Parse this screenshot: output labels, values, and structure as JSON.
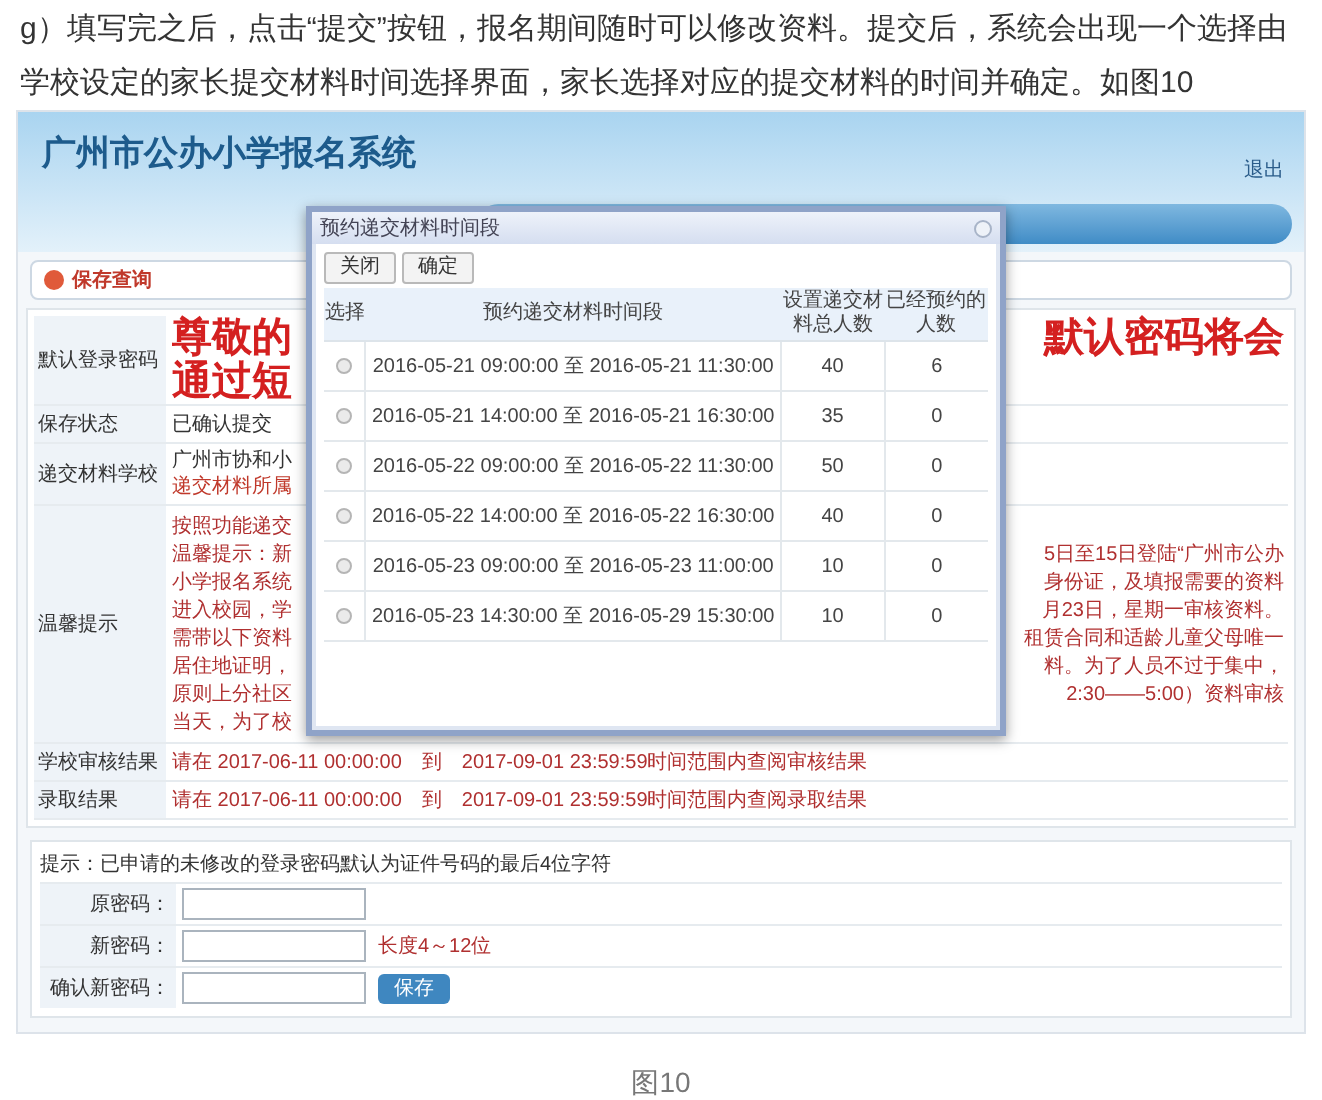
{
  "article": {
    "paragraph": "g）填写完之后，点击“提交”按钮，报名期间随时可以修改资料。提交后，系统会出现一个选择由学校设定的家长提交材料时间选择界面，家长选择对应的提交材料的时间并确定。如图10",
    "caption": "图10"
  },
  "app": {
    "title": "广州市公办小学报名系统",
    "logout": "退出",
    "save_query": "保存查询",
    "info_rows": [
      {
        "kind": "notice",
        "label": "默认登录密码",
        "left": [
          "尊敬的",
          "通过短"
        ],
        "right": [
          "默认密码将会"
        ]
      },
      {
        "kind": "plain",
        "label": "保存状态",
        "value": "已确认提交"
      },
      {
        "kind": "school",
        "label": "递交材料学校",
        "lines": [
          "广州市协和小",
          "递交材料所属"
        ]
      },
      {
        "kind": "tips",
        "label": "温馨提示",
        "lines": [
          {
            "left": "按照功能递交"
          },
          {
            "left": "温馨提示：新",
            "right": "5日至15日登陆“广州市公办"
          },
          {
            "left": "小学报名系统",
            "right": "身份证，及填报需要的资料"
          },
          {
            "left": "进入校园，学",
            "right": "月23日，星期一审核资料。"
          },
          {
            "left": "需带以下资料",
            "right": "租赁合同和适龄儿童父母唯一"
          },
          {
            "left": "居住地证明，",
            "right": "料。为了人员不过于集中，"
          },
          {
            "left": "原则上分社区",
            "right": "2:30——5:00）资料审核"
          },
          {
            "left": "当天，为了校"
          }
        ]
      },
      {
        "kind": "result",
        "label": "学校审核结果",
        "value": "请在 2017-06-11 00:00:00　到　2017-09-01 23:59:59时间范围内查阅审核结果"
      },
      {
        "kind": "result",
        "label": "录取结果",
        "value": "请在 2017-06-11 00:00:00　到　2017-09-01 23:59:59时间范围内查阅录取结果"
      }
    ],
    "password": {
      "hint": "提示：已申请的未修改的登录密码默认为证件号码的最后4位字符",
      "fields": [
        {
          "label": "原密码："
        },
        {
          "label": "新密码：",
          "note": "长度4～12位"
        },
        {
          "label": "确认新密码："
        }
      ],
      "save_button": "保存"
    },
    "dialog": {
      "title": "预约递交材料时间段",
      "buttons": [
        "关闭",
        "确定"
      ],
      "columns": [
        "选择",
        "预约递交材料时间段",
        "设置递交材料总人数",
        "已经预约的人数"
      ],
      "rows": [
        {
          "selected": false,
          "period": "2016-05-21 09:00:00 至 2016-05-21 11:30:00",
          "capacity": "40",
          "booked": "6"
        },
        {
          "selected": false,
          "period": "2016-05-21 14:00:00 至 2016-05-21 16:30:00",
          "capacity": "35",
          "booked": "0"
        },
        {
          "selected": false,
          "period": "2016-05-22 09:00:00 至 2016-05-22 11:30:00",
          "capacity": "50",
          "booked": "0"
        },
        {
          "selected": false,
          "period": "2016-05-22 14:00:00 至 2016-05-22 16:30:00",
          "capacity": "40",
          "booked": "0"
        },
        {
          "selected": false,
          "period": "2016-05-23 09:00:00 至 2016-05-23 11:00:00",
          "capacity": "10",
          "booked": "0"
        },
        {
          "selected": false,
          "period": "2016-05-23 14:30:00 至 2016-05-29 15:30:00",
          "capacity": "10",
          "booked": "0"
        }
      ]
    }
  }
}
